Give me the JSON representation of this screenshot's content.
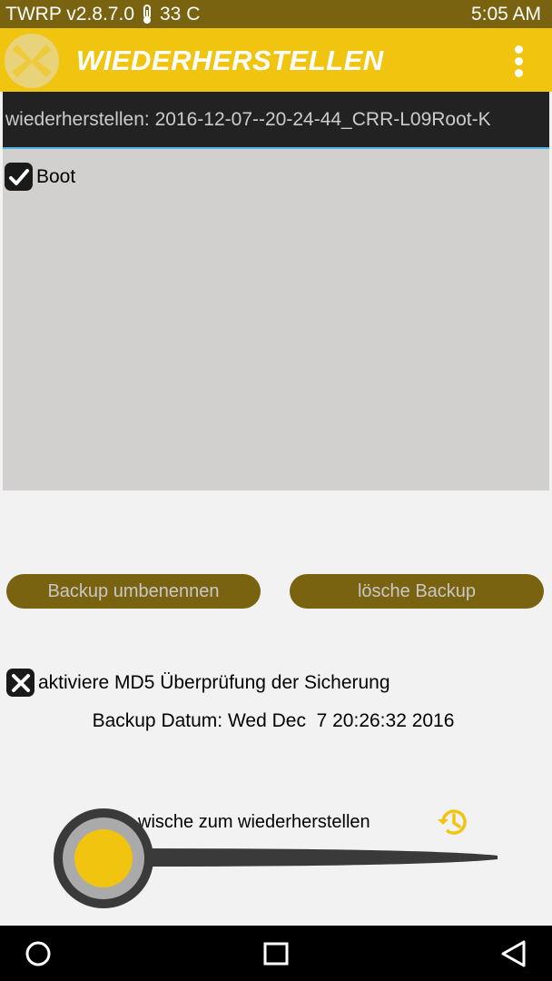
{
  "status_bar": {
    "version": "TWRP v2.8.7.0",
    "temperature": "33 C",
    "time": "5:05 AM"
  },
  "title_bar": {
    "title": "WIEDERHERSTELLEN",
    "menu_icon": "overflow-menu-icon",
    "logo_icon": "twrp-logo"
  },
  "restore_path": "wiederherstellen: 2016-12-07--20-24-44_CRR-L09Root-K",
  "partitions": [
    {
      "label": "Boot",
      "checked": true
    }
  ],
  "buttons": {
    "rename": "Backup umbenennen",
    "delete": "lösche Backup"
  },
  "md5_option": {
    "label": "aktiviere MD5 Überprüfung der Sicherung",
    "checked": false
  },
  "backup_date": "Backup Datum: Wed Dec  7 20:26:32 2016",
  "swipe": {
    "label": "wische zum wiederherstellen"
  },
  "colors": {
    "accent": "#f1c40f",
    "dark_accent": "#7a6310"
  }
}
